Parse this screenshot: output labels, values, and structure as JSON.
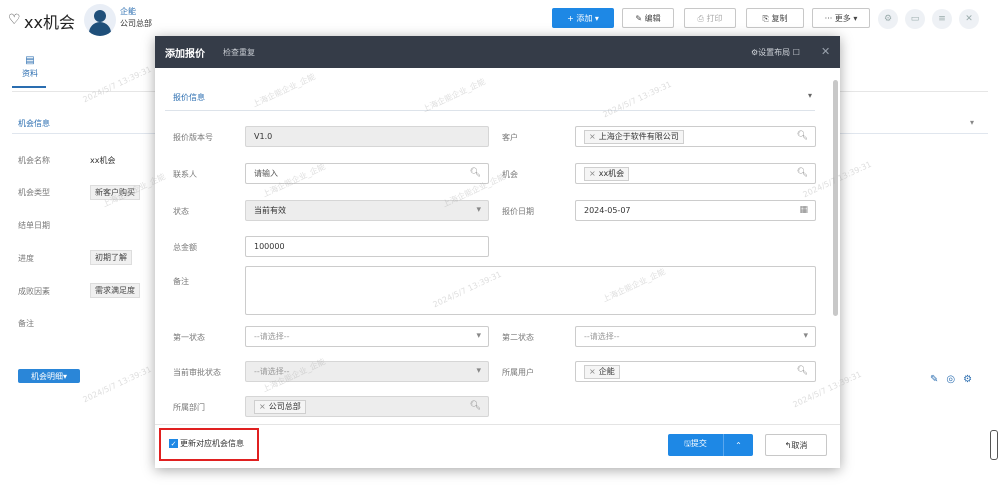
{
  "header": {
    "title": "xx机会",
    "owner_name": "企能",
    "owner_dept": "公司总部",
    "buttons": {
      "add": "+ 添加 ▾",
      "edit": "✎ 编辑",
      "print": "⎙ 打印",
      "copy": "⎘ 复制",
      "more": "··· 更多 ▾"
    }
  },
  "left_tab": {
    "label": "资料"
  },
  "background": {
    "section_title": "机会信息",
    "fields": [
      {
        "label": "机会名称",
        "value": "xx机会"
      },
      {
        "label": "机会类型",
        "value": "新客户购买"
      },
      {
        "label": "结单日期",
        "value": ""
      },
      {
        "label": "进度",
        "value": "初期了解"
      },
      {
        "label": "成败因素",
        "value": "需求满足度"
      },
      {
        "label": "备注",
        "value": ""
      }
    ],
    "detail_button": "机会明细▾"
  },
  "modal": {
    "title": "添加报价",
    "subtitle": "检查重复",
    "layout_label": "⚙设置布局 ☐",
    "close": "✕",
    "group_title": "报价信息",
    "fields": {
      "version": {
        "label": "报价版本号",
        "value": "V1.0"
      },
      "customer": {
        "label": "客户",
        "tag": "上海企于软件有限公司"
      },
      "contact": {
        "label": "联系人",
        "placeholder": "请输入"
      },
      "opportunity": {
        "label": "机会",
        "tag": "xx机会"
      },
      "status": {
        "label": "状态",
        "value": "当前有效"
      },
      "date": {
        "label": "报价日期",
        "value": "2024-05-07"
      },
      "amount": {
        "label": "总金额",
        "value": "100000"
      },
      "remark": {
        "label": "备注",
        "value": ""
      },
      "status1": {
        "label": "第一状态",
        "value": "--请选择--"
      },
      "status2": {
        "label": "第二状态",
        "value": "--请选择--"
      },
      "approval": {
        "label": "当前审批状态",
        "value": "--请选择--"
      },
      "user": {
        "label": "所属用户",
        "tag": "企能"
      },
      "dept": {
        "label": "所属部门",
        "tag": "公司总部"
      }
    },
    "footer": {
      "checkbox_label": "更新对应机会信息",
      "checkbox_checked": true,
      "submit": "🖫提交",
      "submit_caret": "⌃",
      "cancel": "↰取消"
    }
  },
  "watermark": {
    "texts": [
      "上海企能企业_企能",
      "2024/5/7 13:39:31"
    ]
  },
  "colors": {
    "primary": "#1e88e5",
    "header_dark": "#353c48",
    "link_blue": "#2a6db0",
    "highlight_red": "#e02020"
  }
}
